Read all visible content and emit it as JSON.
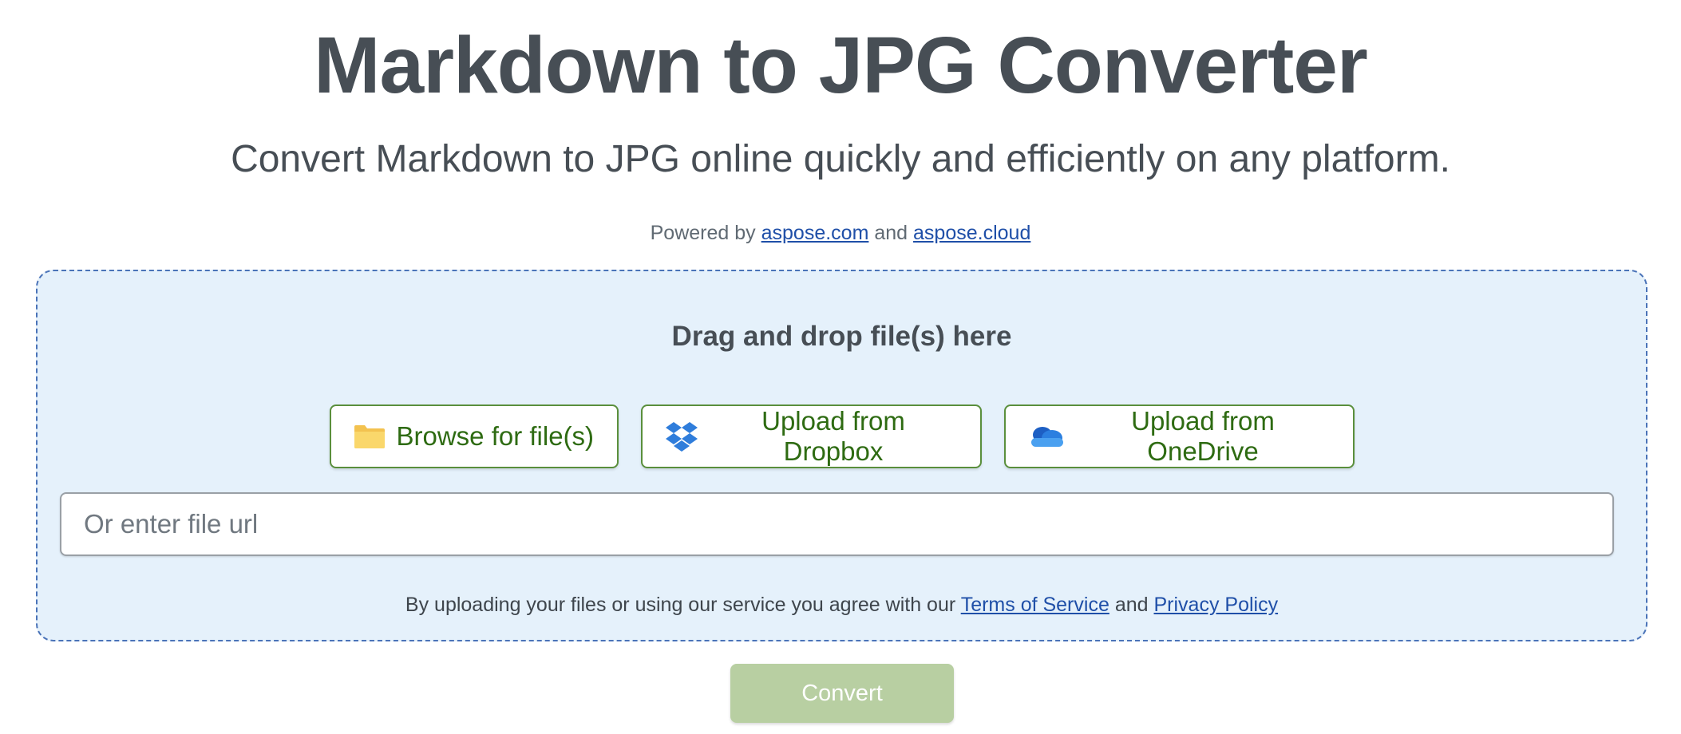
{
  "header": {
    "title": "Markdown to JPG Converter",
    "subtitle": "Convert Markdown to JPG online quickly and efficiently on any platform.",
    "powered_prefix": "Powered by",
    "powered_link1": "aspose.com",
    "powered_and": "and",
    "powered_link2": "aspose.cloud"
  },
  "dropzone": {
    "title": "Drag and drop file(s) here",
    "browse_label": "Browse for file(s)",
    "dropbox_label": "Upload from Dropbox",
    "onedrive_label": "Upload from OneDrive",
    "url_placeholder": "Or enter file url",
    "agree_prefix": "By uploading your files or using our service you agree with our",
    "terms_label": "Terms of Service",
    "agree_and": "and",
    "privacy_label": "Privacy Policy"
  },
  "actions": {
    "convert_label": "Convert"
  },
  "icons": {
    "browse": "folder-icon",
    "dropbox": "dropbox-icon",
    "onedrive": "onedrive-icon"
  },
  "colors": {
    "text": "#474e55",
    "link": "#1f4fa8",
    "dropzone_bg": "#e5f1fb",
    "dropzone_border": "#4a73b8",
    "button_border": "#5a8f3c",
    "button_text": "#2e6b12",
    "convert_bg": "#b8cfa2"
  }
}
